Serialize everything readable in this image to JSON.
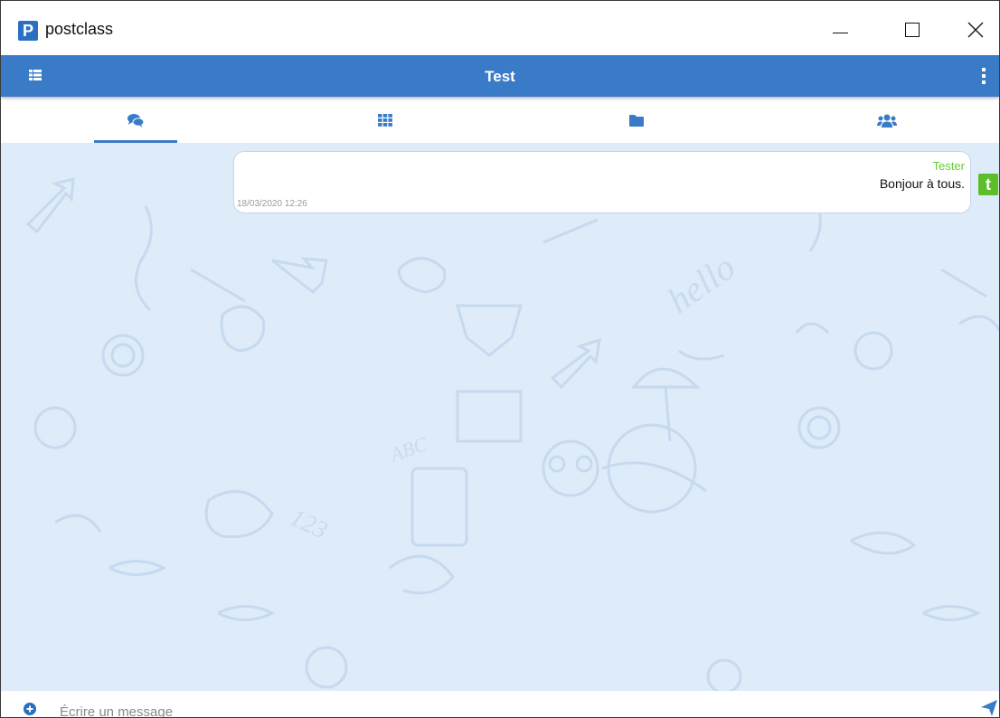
{
  "window": {
    "app_logo_letter": "P",
    "app_title": "postclass"
  },
  "appbar": {
    "title": "Test",
    "accent_color": "#3a7bc8"
  },
  "tabs": [
    {
      "icon": "chat-bubbles-icon",
      "active": true
    },
    {
      "icon": "grid-icon",
      "active": false
    },
    {
      "icon": "folder-icon",
      "active": false
    },
    {
      "icon": "users-icon",
      "active": false
    }
  ],
  "messages": [
    {
      "sender": "Tester",
      "text": "Bonjour à tous.",
      "timestamp": "18/03/2020 12:26",
      "avatar_letter": "t",
      "sender_color": "#66cc33"
    }
  ],
  "composer": {
    "placeholder": "Écrire un message"
  }
}
